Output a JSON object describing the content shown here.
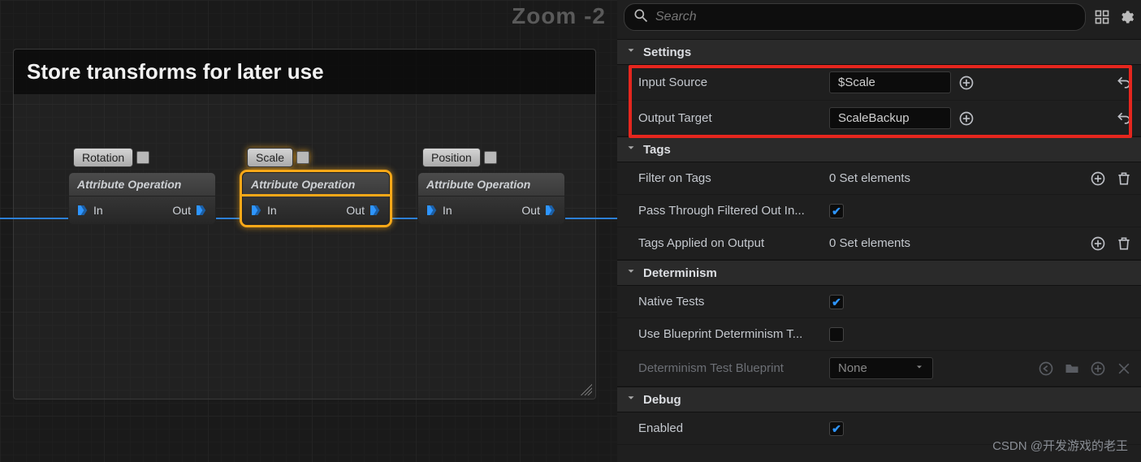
{
  "graph": {
    "zoom_label": "Zoom -2",
    "comment_title": "Store transforms for later use",
    "node_title": "Attribute Operation",
    "pin_in": "In",
    "pin_out": "Out",
    "tags": {
      "rotation": "Rotation",
      "scale": "Scale",
      "position": "Position"
    }
  },
  "search": {
    "placeholder": "Search"
  },
  "sections": {
    "settings": "Settings",
    "tags": "Tags",
    "determinism": "Determinism",
    "debug": "Debug"
  },
  "settings": {
    "input_source_label": "Input Source",
    "input_source_value": "$Scale",
    "output_target_label": "Output Target",
    "output_target_value": "ScaleBackup"
  },
  "tags": {
    "filter_label": "Filter on Tags",
    "filter_value": "0 Set elements",
    "passthrough_label": "Pass Through Filtered Out In...",
    "applied_label": "Tags Applied on Output",
    "applied_value": "0 Set elements"
  },
  "determinism": {
    "native_label": "Native Tests",
    "use_bp_label": "Use Blueprint Determinism T...",
    "bp_test_label": "Determinism Test Blueprint",
    "bp_test_value": "None"
  },
  "debug": {
    "enabled_label": "Enabled"
  },
  "watermark": "CSDN @开发游戏的老王"
}
